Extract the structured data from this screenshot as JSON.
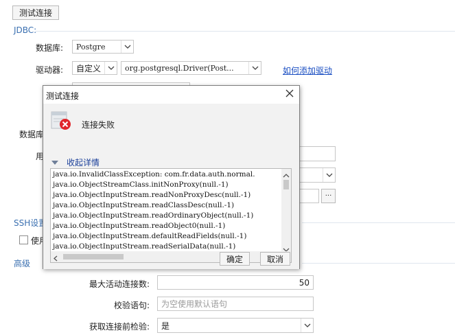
{
  "top_button": "测试连接",
  "jdbc": {
    "section": "JDBC:",
    "db_label": "数据库:",
    "db_value": "Postgre",
    "driver_label": "驱动器:",
    "driver_mode": "自定义",
    "driver_class": "org.postgresql.Driver(Post...",
    "add_driver_link": "如何添加驱动",
    "hidden_db_label": "数据库",
    "hidden_user_label": "用"
  },
  "ssh": {
    "section": "SSH设置",
    "use_label": "使用"
  },
  "advanced": {
    "section": "高级",
    "max_active_label": "最大活动连接数:",
    "max_active_value": "50",
    "validation_label": "校验语句:",
    "validation_placeholder": "为空使用默认语句",
    "test_on_borrow_label": "获取连接前检验:",
    "test_on_borrow_value": "是"
  },
  "dialog": {
    "title": "测试连接",
    "status": "连接失败",
    "details_toggle": "收起详情",
    "log_lines": [
      "java.io.InvalidClassException: com.fr.data.auth.normal.",
      "java.io.ObjectStreamClass.initNonProxy(null.-1)",
      "java.io.ObjectInputStream.readNonProxyDesc(null.-1)",
      "java.io.ObjectInputStream.readClassDesc(null.-1)",
      "java.io.ObjectInputStream.readOrdinaryObject(null.-1)",
      "java.io.ObjectInputStream.readObject0(null.-1)",
      "java.io.ObjectInputStream.defaultReadFields(null.-1)",
      "java.io.ObjectInputStream.readSerialData(null.-1)"
    ],
    "ok_button": "确定",
    "cancel_button": "取消"
  },
  "colors": {
    "section_title": "#3a6fb0",
    "link": "#1a4ec2",
    "error_red": "#e0262b"
  },
  "icons": [
    "close-icon",
    "error-icon",
    "chevron-down-icon",
    "ellipsis-icon"
  ]
}
